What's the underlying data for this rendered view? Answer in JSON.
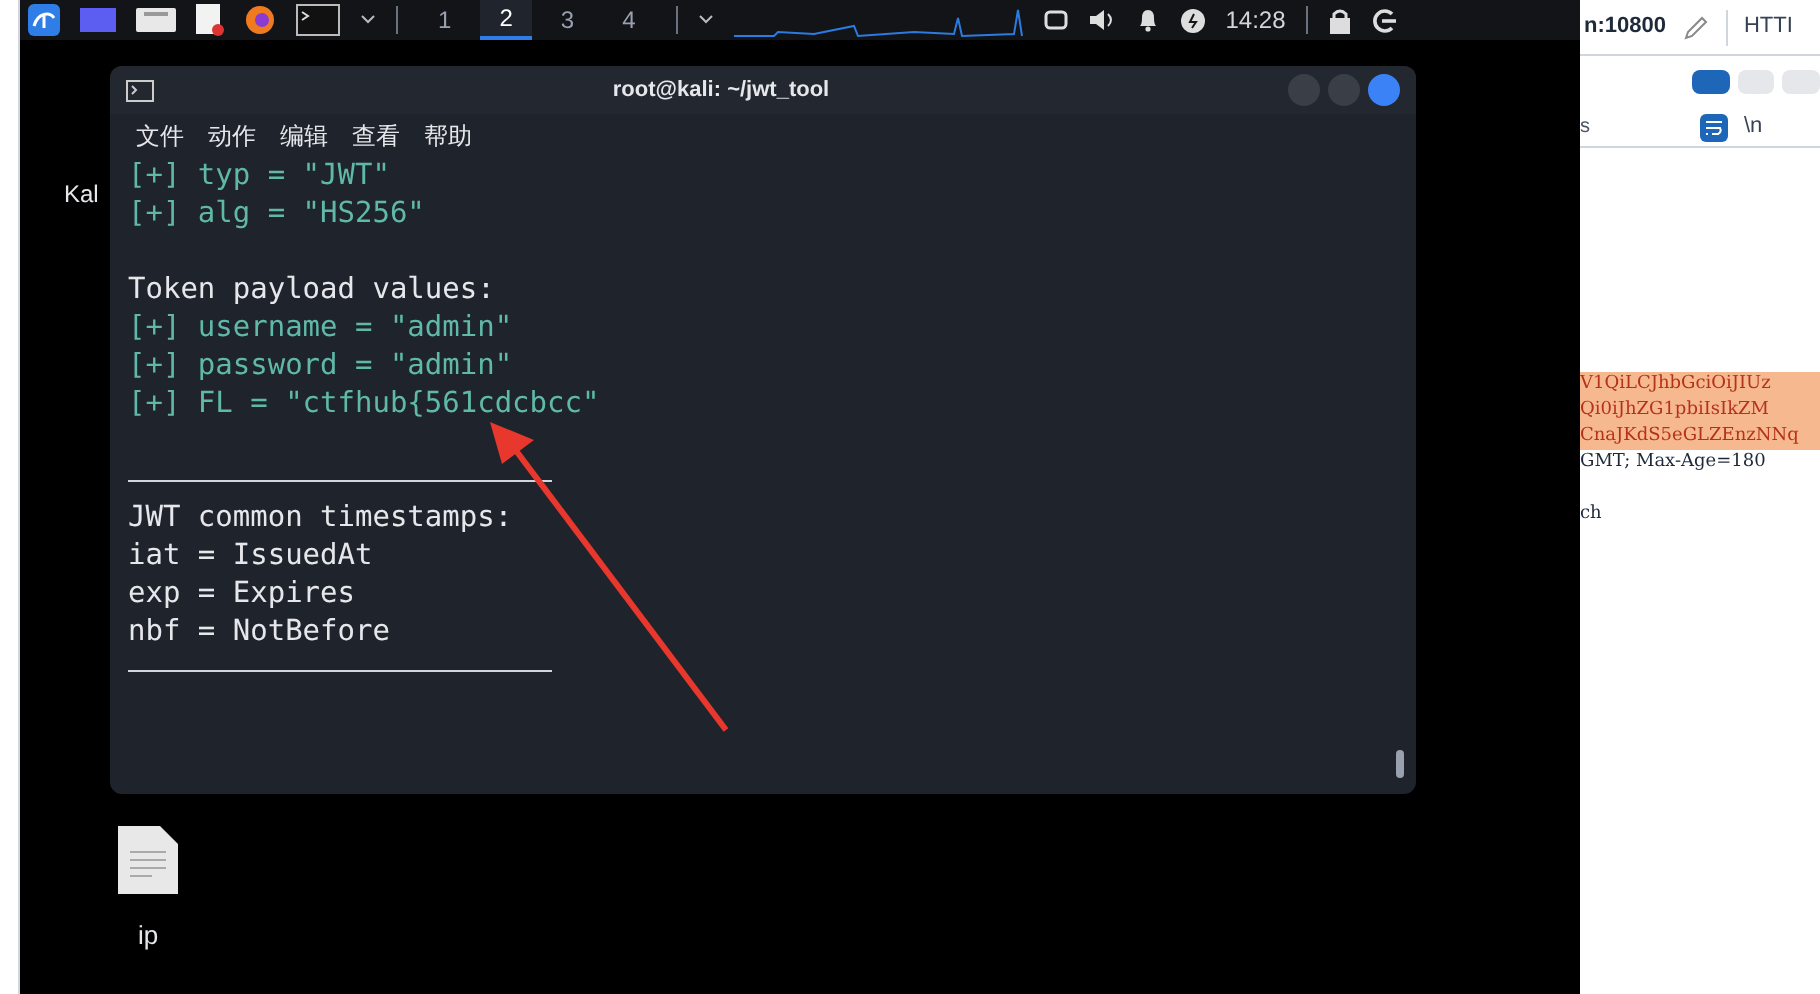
{
  "taskbar": {
    "workspaces": [
      {
        "label": "1",
        "selected": false
      },
      {
        "label": "2",
        "selected": true
      },
      {
        "label": "3",
        "selected": false
      },
      {
        "label": "4",
        "selected": false
      }
    ],
    "clock": "14:28"
  },
  "desktop": {
    "fragment": "Kal",
    "file_icon": {
      "label": "ip"
    }
  },
  "terminal": {
    "title": "root@kali: ~/jwt_tool",
    "menu": [
      "文件",
      "动作",
      "编辑",
      "查看",
      "帮助"
    ],
    "lines": [
      {
        "kind": "found",
        "text": "[+] typ = \"JWT\""
      },
      {
        "kind": "found",
        "text": "[+] alg = \"HS256\""
      },
      {
        "kind": "blank"
      },
      {
        "kind": "plain",
        "text": "Token payload values:"
      },
      {
        "kind": "found",
        "text": "[+] username = \"admin\""
      },
      {
        "kind": "found",
        "text": "[+] password = \"admin\""
      },
      {
        "kind": "found",
        "text": "[+] FL = \"ctfhub{561cdcbcc\""
      },
      {
        "kind": "blank"
      },
      {
        "kind": "rule"
      },
      {
        "kind": "plain",
        "text": "JWT common timestamps:"
      },
      {
        "kind": "plain",
        "text": "iat = IssuedAt"
      },
      {
        "kind": "plain",
        "text": "exp = Expires"
      },
      {
        "kind": "plain",
        "text": "nbf = NotBefore"
      },
      {
        "kind": "rule"
      }
    ]
  },
  "browser_panel": {
    "address": "n:10800",
    "tab": "HTTI",
    "section_label": "s",
    "newline_toggle": "\\n",
    "lines": [
      {
        "kind": "highlight",
        "text": "V1QiLCJhbGciOiJIUz"
      },
      {
        "kind": "highlight",
        "text": "Qi0iJhZG1pbiIsIkZM"
      },
      {
        "kind": "highlight",
        "text": "CnaJKdS5eGLZEnzNNq"
      },
      {
        "kind": "plain",
        "text": "GMT; Max-Age=180"
      },
      {
        "kind": "blank"
      },
      {
        "kind": "plain",
        "text": "ch"
      }
    ]
  }
}
